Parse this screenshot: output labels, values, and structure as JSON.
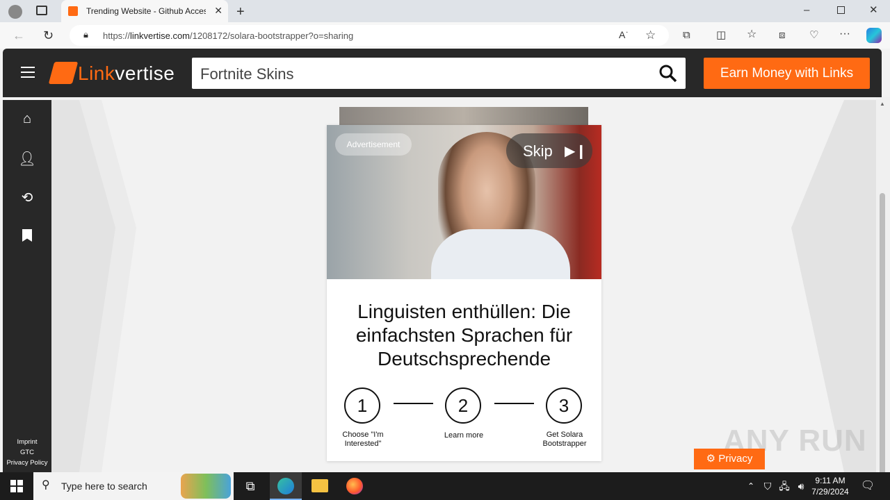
{
  "browser": {
    "tab_title": "Trending Website - Github Acces",
    "url_prefix": "https://",
    "url_host": "linkvertise.com",
    "url_path": "/1208172/solara-bootstrapper?o=sharing"
  },
  "site": {
    "logo_part1": "Link",
    "logo_part2": "vertise",
    "search_value": "Fortnite Skins",
    "earn_button": "Earn Money with Links",
    "footer_links": [
      "Imprint",
      "GTC",
      "Privacy Policy"
    ]
  },
  "ad": {
    "badge": "Advertisement",
    "skip_label": "Skip",
    "headline": "Linguisten enthüllen: Die einfachsten Sprachen für Deutschsprechende",
    "steps": [
      {
        "number": "1",
        "label": "Choose \"I'm Interested\""
      },
      {
        "number": "2",
        "label": "Learn more"
      },
      {
        "number": "3",
        "label": "Get Solara Bootstrapper"
      }
    ]
  },
  "privacy_button": "Privacy",
  "watermark": "ANY RUN",
  "taskbar": {
    "search_placeholder": "Type here to search",
    "time": "9:11 AM",
    "date": "7/29/2024"
  },
  "colors": {
    "brand_orange": "#ff6a13",
    "header_dark": "#282828"
  }
}
